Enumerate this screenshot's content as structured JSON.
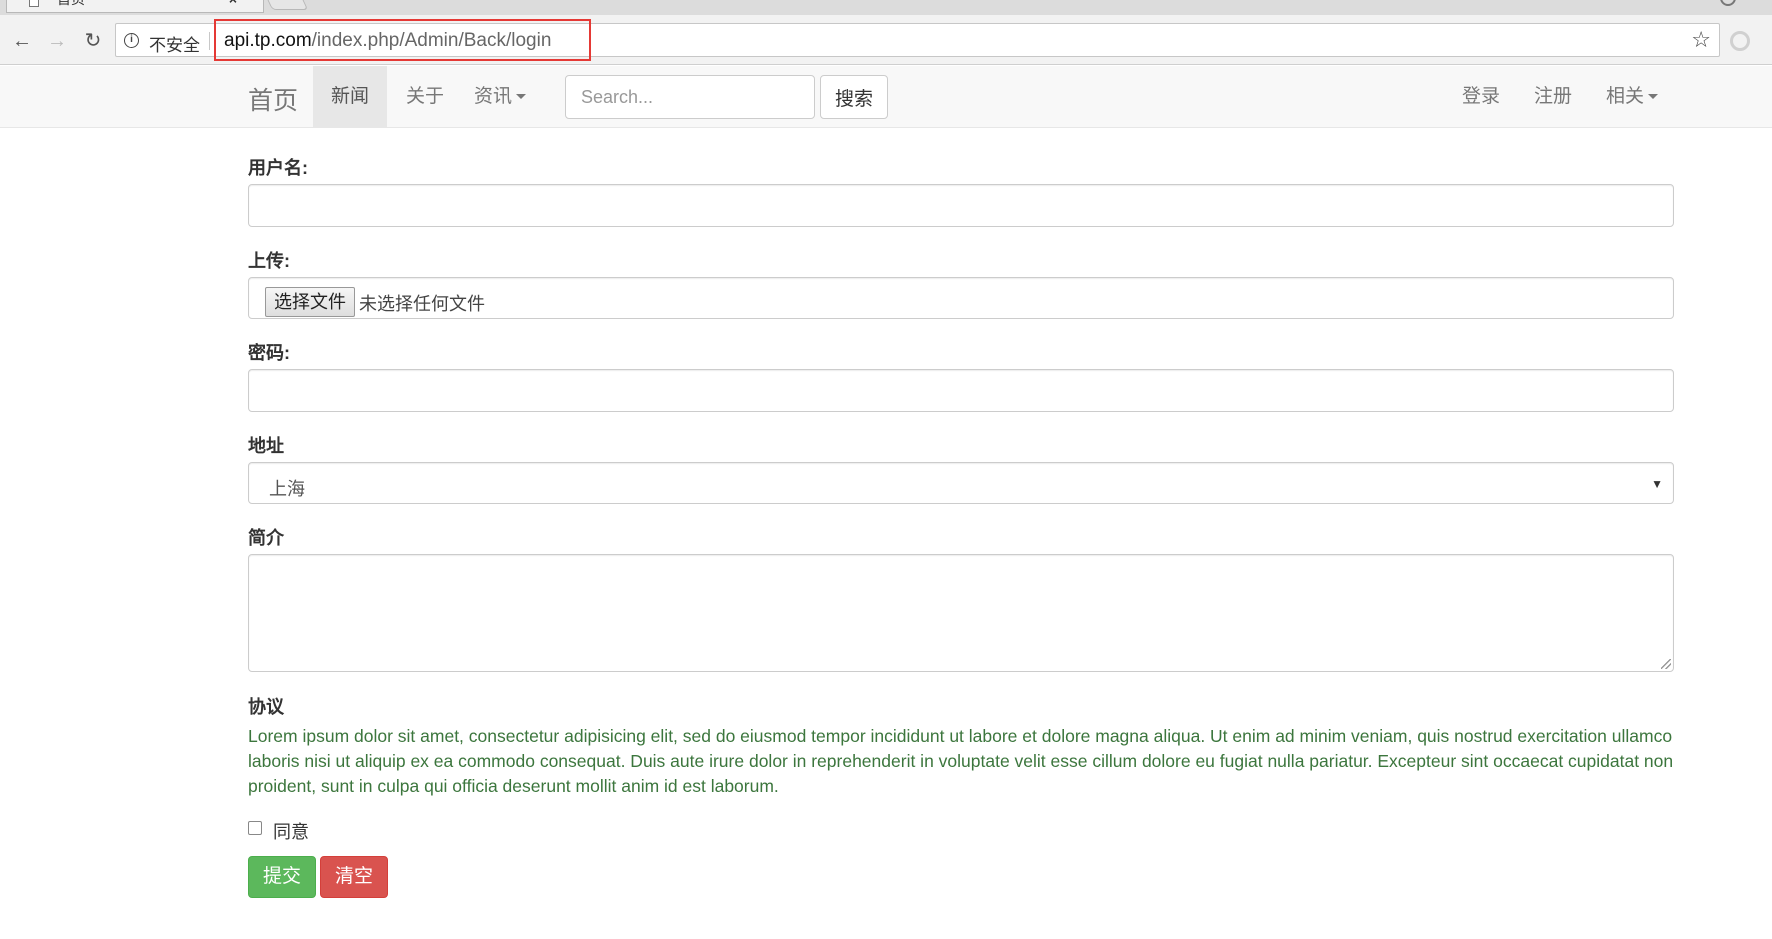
{
  "browser": {
    "tab_title": "首页",
    "tab_close": "×",
    "insecure_label": "不安全",
    "url_host": "api.tp.com",
    "url_path": "/index.php/Admin/Back/login",
    "highlight_color": "#e53935"
  },
  "navbar": {
    "brand": "首页",
    "links": [
      "新闻",
      "关于",
      "资讯"
    ],
    "active_link": "新闻",
    "search_placeholder": "Search...",
    "search_button": "搜索",
    "right_links": [
      "登录",
      "注册",
      "相关"
    ]
  },
  "form": {
    "username_label": "用户名:",
    "upload_label": "上传:",
    "file_button": "选择文件",
    "file_status": "未选择任何文件",
    "password_label": "密码:",
    "address_label": "地址",
    "address_value": "上海",
    "intro_label": "简介",
    "agreement_label": "协议",
    "agreement_text": "Lorem ipsum dolor sit amet, consectetur adipisicing elit, sed do eiusmod tempor incididunt ut labore et dolore magna aliqua. Ut enim ad minim veniam, quis nostrud exercitation ullamco laboris nisi ut aliquip ex ea commodo consequat. Duis aute irure dolor in reprehenderit in voluptate velit esse cillum dolore eu fugiat nulla pariatur. Excepteur sint occaecat cupidatat non proident, sunt in culpa qui officia deserunt mollit anim id est laborum.",
    "agree_label": "同意",
    "submit_button": "提交",
    "clear_button": "清空",
    "colors": {
      "submit": "#5cb85c",
      "clear": "#d9534f",
      "agreement_text": "#3c763d"
    }
  }
}
